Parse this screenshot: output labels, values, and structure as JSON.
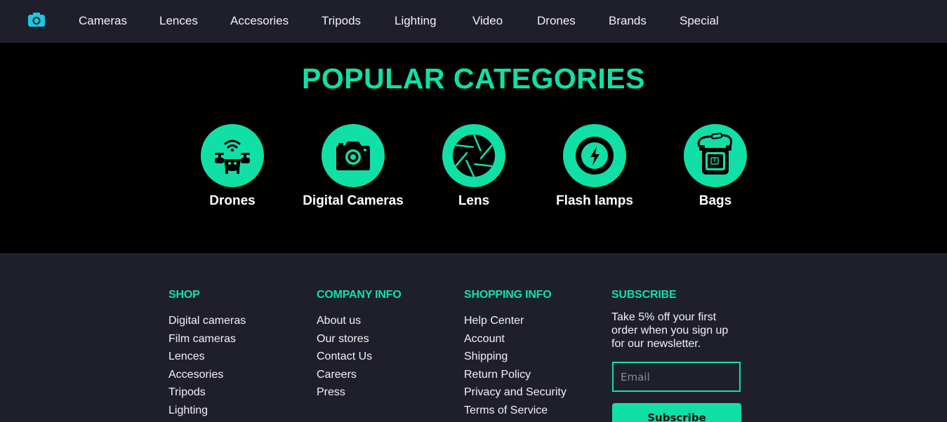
{
  "nav": {
    "items": [
      {
        "label": "Cameras"
      },
      {
        "label": "Lences"
      },
      {
        "label": "Accesories"
      },
      {
        "label": "Tripods"
      },
      {
        "label": "Lighting"
      },
      {
        "label": "Video"
      },
      {
        "label": "Drones"
      },
      {
        "label": "Brands"
      },
      {
        "label": "Special"
      }
    ],
    "logo_icon": "camera-icon"
  },
  "categories": {
    "title": "POPULAR CATEGORIES",
    "items": [
      {
        "label": "Drones",
        "icon": "drone-icon"
      },
      {
        "label": "Digital Cameras",
        "icon": "camera-icon"
      },
      {
        "label": "Lens",
        "icon": "aperture-icon"
      },
      {
        "label": "Flash lamps",
        "icon": "flash-icon"
      },
      {
        "label": "Bags",
        "icon": "camera-bag-icon"
      }
    ]
  },
  "footer": {
    "shop": {
      "heading": "SHOP",
      "links": [
        "Digital cameras",
        "Film cameras",
        "Lences",
        "Accesories",
        "Tripods",
        "Lighting"
      ]
    },
    "company": {
      "heading": "COMPANY INFO",
      "links": [
        "About us",
        "Our stores",
        "Contact Us",
        "Careers",
        "Press"
      ]
    },
    "shopping": {
      "heading": "SHOPPING INFO",
      "links": [
        "Help Center",
        "Account",
        "Shipping",
        "Return Policy",
        "Privacy and Security",
        "Terms of Service"
      ]
    },
    "subscribe": {
      "heading": "SUBSCRIBE",
      "text": "Take 5% off your first order when you sign up for our newsletter.",
      "email_placeholder": "Email",
      "button_label": "Subscribe"
    }
  },
  "colors": {
    "accent": "#11e0a6",
    "nav_bg": "#1f1f2c",
    "section_bg": "#000000",
    "logo": "#1ec8e0"
  }
}
